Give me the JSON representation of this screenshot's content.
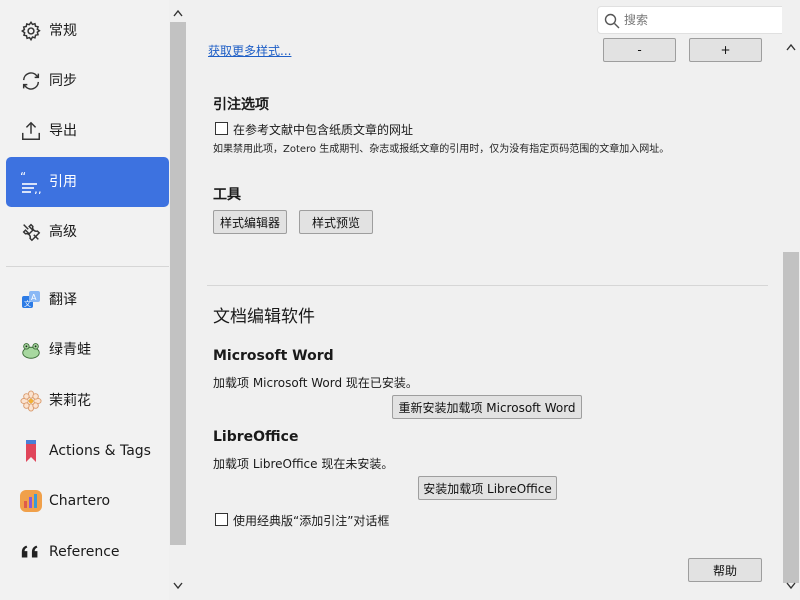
{
  "sidebar": {
    "items": [
      {
        "label": "常规",
        "icon": "gear-icon"
      },
      {
        "label": "同步",
        "icon": "sync-icon"
      },
      {
        "label": "导出",
        "icon": "export-icon"
      },
      {
        "label": "引用",
        "icon": "quote-icon",
        "active": true
      },
      {
        "label": "高级",
        "icon": "tools-icon"
      },
      {
        "label": "翻译",
        "icon": "translate-icon"
      },
      {
        "label": "绿青蛙",
        "icon": "frog-icon"
      },
      {
        "label": "茉莉花",
        "icon": "jasmine-icon"
      },
      {
        "label": "Actions & Tags",
        "icon": "bookmark-icon"
      },
      {
        "label": "Chartero",
        "icon": "chart-icon"
      },
      {
        "label": "Reference",
        "icon": "quote-marks-icon"
      }
    ]
  },
  "search": {
    "placeholder": "搜索"
  },
  "styles": {
    "more_link": "获取更多样式...",
    "minus_label": "-",
    "plus_label": "+"
  },
  "citation_options": {
    "title": "引注选项",
    "include_urls_label": "在参考文献中包含纸质文章的网址",
    "include_urls_hint": "如果禁用此项，Zotero 生成期刊、杂志或报纸文章的引用时，仅为没有指定页码范围的文章加入网址。"
  },
  "tools": {
    "title": "工具",
    "style_editor_label": "样式编辑器",
    "style_preview_label": "样式预览"
  },
  "word_processors": {
    "title": "文档编辑软件",
    "word": {
      "title": "Microsoft Word",
      "status": "加载项 Microsoft Word 现在已安装。",
      "button_label": "重新安装加载项 Microsoft Word"
    },
    "libreoffice": {
      "title": "LibreOffice",
      "status": "加载项 LibreOffice 现在未安装。",
      "button_label": "安装加载项 LibreOffice"
    },
    "classic_dialog_label": "使用经典版“添加引注”对话框"
  },
  "help_label": "帮助",
  "colors": {
    "accent": "#3d72e0",
    "link": "#1f5fc6"
  }
}
